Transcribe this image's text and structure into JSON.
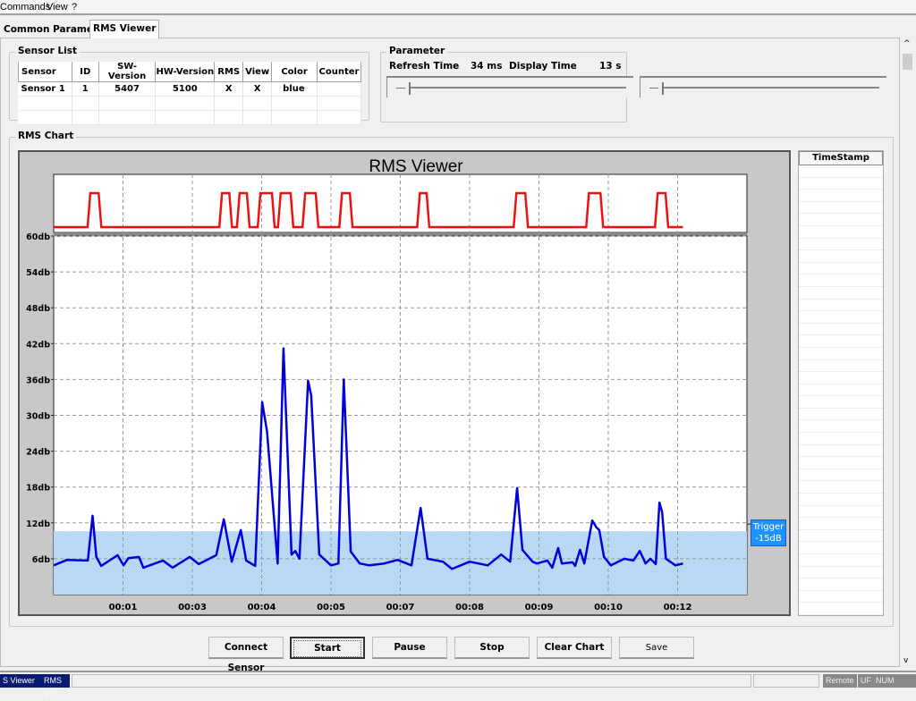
{
  "menu": {
    "items": [
      "Commands",
      "View",
      "?"
    ]
  },
  "tabs": [
    {
      "label": "Common Parameter",
      "active": false
    },
    {
      "label": "RMS Viewer",
      "active": true
    }
  ],
  "sensor_list": {
    "title": "Sensor List",
    "columns": [
      "Sensor",
      "ID",
      "SW-Version",
      "HW-Version",
      "RMS",
      "View",
      "Color",
      "Counter"
    ],
    "rows": [
      [
        "Sensor 1",
        "1",
        "5407",
        "5100",
        "X",
        "X",
        "blue",
        ""
      ]
    ]
  },
  "parameter": {
    "title": "Parameter",
    "refresh_label": "Refresh Time",
    "refresh_value": "34 ms",
    "display_label": "Display Time",
    "display_value": "13 s",
    "slider1_level": 0.02,
    "slider2_level": 0.02
  },
  "rms_chart_group": {
    "title": "RMS Chart"
  },
  "timestamp": {
    "header": "TimeStamp"
  },
  "chart_data": {
    "type": "line",
    "title": "RMS Viewer",
    "xlim": [
      0,
      13
    ],
    "ylim": [
      0,
      60
    ],
    "grid": true,
    "ytick_labels": [
      "6db",
      "12db",
      "18db",
      "24db",
      "30db",
      "36db",
      "42db",
      "48db",
      "54db",
      "60db"
    ],
    "yticks": [
      6,
      12,
      18,
      24,
      30,
      36,
      42,
      48,
      54,
      60
    ],
    "xticks": [
      1.3,
      2.6,
      3.9,
      5.2,
      6.5,
      7.8,
      9.1,
      10.4,
      11.7
    ],
    "xtick_labels": [
      "00:01",
      "00:03",
      "00:04",
      "00:05",
      "00:07",
      "00:08",
      "00:09",
      "00:10",
      "00:12"
    ],
    "trigger": {
      "label_line1": "Trigger",
      "label_line2": "-15dB",
      "level_db": 10.6,
      "color": "#1e90ff"
    },
    "series": [
      {
        "color": "#0000dd",
        "points": [
          [
            0,
            4.9
          ],
          [
            0.25,
            5.8
          ],
          [
            0.64,
            5.7
          ],
          [
            0.73,
            13.2
          ],
          [
            0.8,
            6.3
          ],
          [
            0.89,
            4.8
          ],
          [
            1.2,
            6.6
          ],
          [
            1.31,
            4.9
          ],
          [
            1.4,
            6.1
          ],
          [
            1.6,
            6.3
          ],
          [
            1.68,
            4.5
          ],
          [
            2.05,
            5.7
          ],
          [
            2.23,
            4.5
          ],
          [
            2.55,
            6.3
          ],
          [
            2.72,
            5.1
          ],
          [
            3.05,
            6.6
          ],
          [
            3.19,
            12.6
          ],
          [
            3.34,
            5.5
          ],
          [
            3.51,
            10.8
          ],
          [
            3.61,
            5.7
          ],
          [
            3.78,
            4.8
          ],
          [
            3.91,
            32.2
          ],
          [
            4.0,
            27.3
          ],
          [
            4.2,
            5.2
          ],
          [
            4.31,
            41.2
          ],
          [
            4.46,
            6.7
          ],
          [
            4.53,
            7.3
          ],
          [
            4.61,
            6.0
          ],
          [
            4.77,
            35.8
          ],
          [
            4.83,
            33.3
          ],
          [
            4.98,
            6.7
          ],
          [
            5.2,
            4.9
          ],
          [
            5.34,
            5.2
          ],
          [
            5.44,
            36.0
          ],
          [
            5.57,
            7.2
          ],
          [
            5.74,
            5.2
          ],
          [
            5.92,
            4.9
          ],
          [
            6.2,
            5.2
          ],
          [
            6.45,
            5.8
          ],
          [
            6.71,
            4.9
          ],
          [
            6.88,
            14.5
          ],
          [
            7.01,
            6.0
          ],
          [
            7.3,
            5.5
          ],
          [
            7.47,
            4.3
          ],
          [
            7.8,
            5.5
          ],
          [
            8.14,
            4.9
          ],
          [
            8.39,
            6.7
          ],
          [
            8.56,
            5.5
          ],
          [
            8.69,
            17.8
          ],
          [
            8.79,
            7.5
          ],
          [
            8.98,
            5.5
          ],
          [
            9.06,
            5.2
          ],
          [
            9.26,
            5.7
          ],
          [
            9.35,
            4.5
          ],
          [
            9.46,
            7.8
          ],
          [
            9.53,
            5.2
          ],
          [
            9.73,
            5.4
          ],
          [
            9.78,
            4.8
          ],
          [
            9.87,
            7.5
          ],
          [
            9.95,
            5.2
          ],
          [
            10.1,
            12.4
          ],
          [
            10.18,
            11.2
          ],
          [
            10.23,
            10.8
          ],
          [
            10.32,
            6.3
          ],
          [
            10.45,
            4.9
          ],
          [
            10.7,
            6.0
          ],
          [
            10.87,
            5.7
          ],
          [
            10.99,
            7.3
          ],
          [
            11.1,
            5.2
          ],
          [
            11.19,
            6.0
          ],
          [
            11.29,
            5.1
          ],
          [
            11.36,
            15.4
          ],
          [
            11.41,
            13.8
          ],
          [
            11.48,
            6.0
          ],
          [
            11.66,
            4.9
          ],
          [
            11.8,
            5.2
          ]
        ]
      }
    ],
    "trigger_pulses": {
      "color": "#ee1111",
      "end": 11.8,
      "intervals": [
        [
          0.67,
          0.86
        ],
        [
          3.14,
          3.31
        ],
        [
          3.47,
          3.64
        ],
        [
          3.86,
          4.11
        ],
        [
          4.24,
          4.46
        ],
        [
          4.7,
          4.93
        ],
        [
          5.39,
          5.57
        ],
        [
          6.85,
          7.01
        ],
        [
          8.66,
          8.86
        ],
        [
          10.02,
          10.27
        ],
        [
          11.31,
          11.49
        ]
      ]
    }
  },
  "buttons": {
    "connect": "Connect Sensor",
    "start": "Start",
    "pause": "Pause",
    "stop": "Stop",
    "clear": "Clear Chart",
    "save": "Save"
  },
  "statusbar": {
    "task1": "S Viewer",
    "task2": "RMS Vi",
    "remote": "Remote",
    "uf": "UF",
    "num": "NUM"
  }
}
